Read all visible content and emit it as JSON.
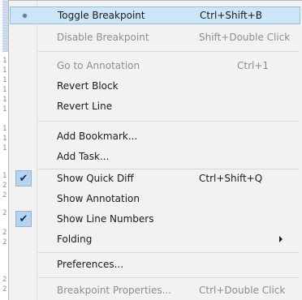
{
  "gutter": {
    "line_numbers": [
      "1",
      "1",
      "1",
      "1",
      "1",
      "1",
      "1",
      "1",
      "1",
      "1",
      "2",
      "2",
      "2",
      "2",
      "2",
      "2",
      "2"
    ]
  },
  "menu": {
    "items": [
      {
        "label": "Toggle Breakpoint",
        "shortcut": "Ctrl+Shift+B",
        "enabled": true,
        "highlighted": true,
        "icon": "breakpoint-dot-icon"
      },
      {
        "label": "Disable Breakpoint",
        "shortcut": "Shift+Double Click",
        "enabled": false
      },
      {
        "label": "Go to Annotation",
        "shortcut": "Ctrl+1",
        "enabled": false
      },
      {
        "label": "Revert Block",
        "shortcut": "",
        "enabled": true
      },
      {
        "label": "Revert Line",
        "shortcut": "",
        "enabled": true
      },
      {
        "label": "Add Bookmark...",
        "shortcut": "",
        "enabled": true
      },
      {
        "label": "Add Task...",
        "shortcut": "",
        "enabled": true
      },
      {
        "label": "Show Quick Diff",
        "shortcut": "Ctrl+Shift+Q",
        "enabled": true,
        "checked": true
      },
      {
        "label": "Show Annotation",
        "shortcut": "",
        "enabled": true
      },
      {
        "label": "Show Line Numbers",
        "shortcut": "",
        "enabled": true,
        "checked": true
      },
      {
        "label": "Folding",
        "shortcut": "",
        "enabled": true,
        "submenu": true
      },
      {
        "label": "Preferences...",
        "shortcut": "",
        "enabled": true
      },
      {
        "label": "Breakpoint Properties...",
        "shortcut": "Ctrl+Double Click",
        "enabled": false
      }
    ]
  },
  "colors": {
    "highlight_bg": "#cde6f7",
    "highlight_border": "#92c0e0",
    "disabled_text": "#8d8d8d",
    "menu_bg": "#f2f2f2"
  }
}
